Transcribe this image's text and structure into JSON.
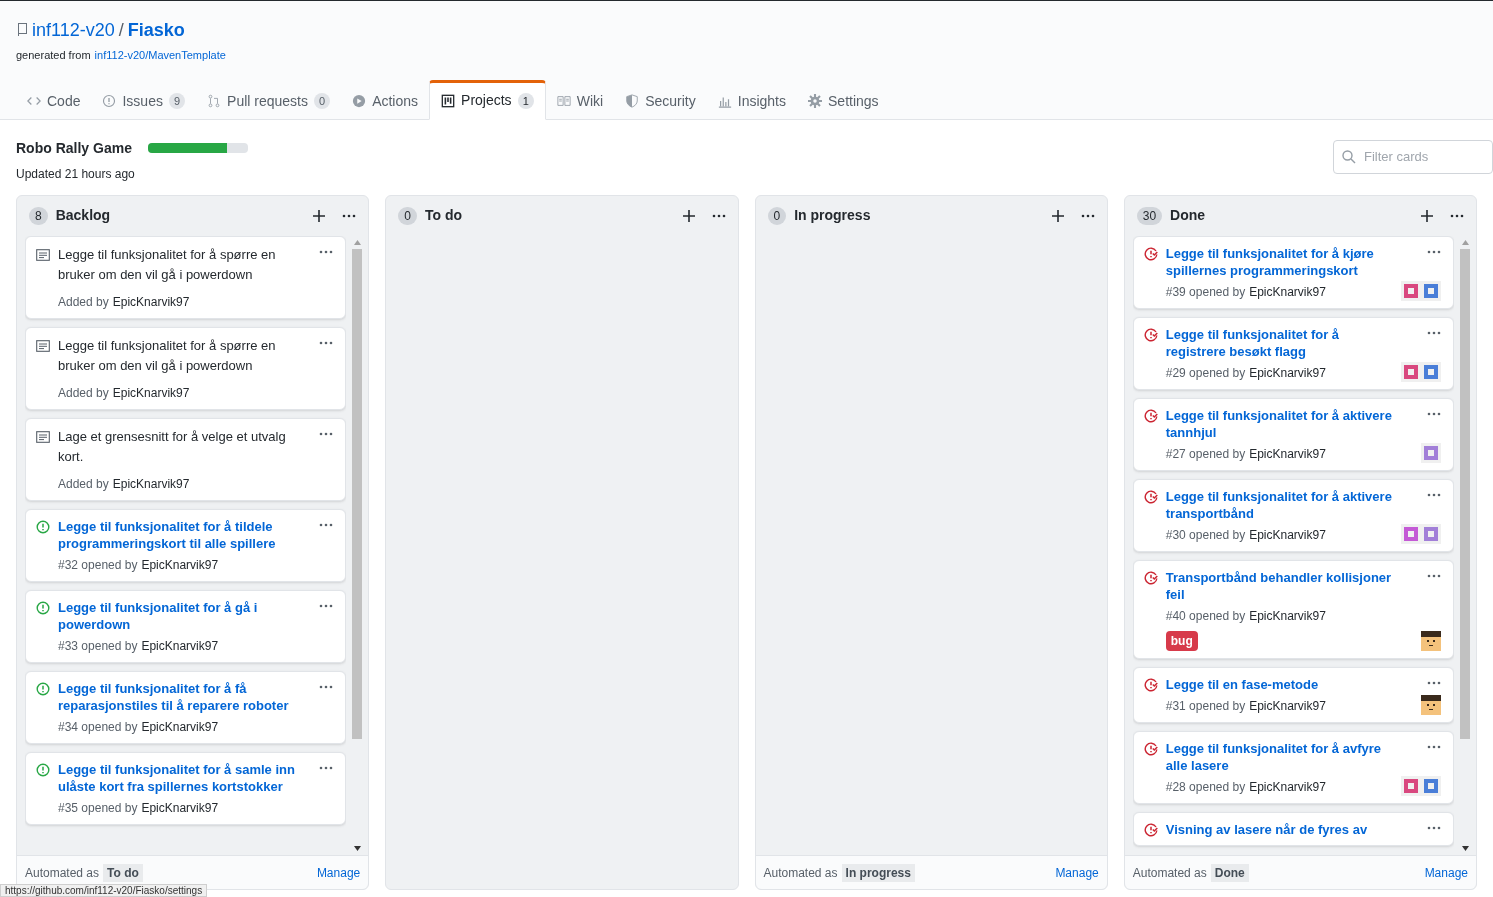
{
  "repo": {
    "owner": "inf112-v20",
    "separator": "/",
    "name": "Fiasko",
    "generated_label": "generated from",
    "template": "inf112-v20/MavenTemplate"
  },
  "tabs": [
    {
      "label": "Code",
      "selected": false
    },
    {
      "label": "Issues",
      "count": "9",
      "selected": false
    },
    {
      "label": "Pull requests",
      "count": "0",
      "selected": false
    },
    {
      "label": "Actions",
      "selected": false
    },
    {
      "label": "Projects",
      "count": "1",
      "selected": true
    },
    {
      "label": "Wiki",
      "selected": false
    },
    {
      "label": "Security",
      "selected": false
    },
    {
      "label": "Insights",
      "selected": false
    },
    {
      "label": "Settings",
      "selected": false
    }
  ],
  "project": {
    "title": "Robo Rally Game",
    "level": 0.79,
    "updated": "Updated 21 hours ago",
    "filter_placeholder": "Filter cards"
  },
  "columns": [
    {
      "count": "8",
      "name": "Backlog",
      "automated_label": "Automated as",
      "automated_value": "To do",
      "manage": "Manage",
      "cards": [
        {
          "kind": "note",
          "title": "Legge til funksjonalitet for å spørre en bruker om den vil gå i powerdown",
          "meta_label": "Added by",
          "author": "EpicKnarvik97"
        },
        {
          "kind": "note",
          "title": "Legge til funksjonalitet for å spørre en bruker om den vil gå i powerdown",
          "meta_label": "Added by",
          "author": "EpicKnarvik97"
        },
        {
          "kind": "note",
          "title": "Lage et grensesnitt for å velge et utvalg kort.",
          "meta_label": "Added by",
          "author": "EpicKnarvik97"
        },
        {
          "kind": "open_issue",
          "title": "Legge til funksjonalitet for å tildele programmeringskort til alle spillere",
          "meta_label": "#32 opened by",
          "author": "EpicKnarvik97"
        },
        {
          "kind": "open_issue",
          "title": "Legge til funksjonalitet for å gå i powerdown",
          "meta_label": "#33 opened by",
          "author": "EpicKnarvik97"
        },
        {
          "kind": "open_issue",
          "title": "Legge til funksjonalitet for å få reparasjonstiles til å reparere roboter",
          "meta_label": "#34 opened by",
          "author": "EpicKnarvik97"
        },
        {
          "kind": "open_issue",
          "title": "Legge til funksjonalitet for å samle inn ulåste kort fra spillernes kortstokker",
          "meta_label": "#35 opened by",
          "author": "EpicKnarvik97"
        }
      ]
    },
    {
      "count": "0",
      "name": "To do"
    },
    {
      "count": "0",
      "name": "In progress",
      "automated_label": "Automated as",
      "automated_value": "In progress",
      "manage": "Manage"
    },
    {
      "count": "30",
      "name": "Done",
      "automated_label": "Automated as",
      "automated_value": "Done",
      "manage": "Manage",
      "cards": [
        {
          "kind": "closed_issue",
          "title": "Legge til funksjonalitet for å kjøre spillernes programmeringskort",
          "meta_label": "#39 opened by",
          "author": "EpicKnarvik97",
          "avatars": [
            {
              "kind": "identicon",
              "color": "#d9487f"
            },
            {
              "kind": "identicon",
              "color": "#4a7ed8"
            }
          ]
        },
        {
          "kind": "closed_issue",
          "title": "Legge til funksjonalitet for å registrere besøkt flagg",
          "meta_label": "#29 opened by",
          "author": "EpicKnarvik97",
          "avatars": [
            {
              "kind": "identicon",
              "color": "#d9487f"
            },
            {
              "kind": "identicon",
              "color": "#4a7ed8"
            }
          ]
        },
        {
          "kind": "closed_issue",
          "title": "Legge til funksjonalitet for å aktivere tannhjul",
          "meta_label": "#27 opened by",
          "author": "EpicKnarvik97",
          "avatars": [
            {
              "kind": "identicon",
              "color": "#a27fd8"
            }
          ]
        },
        {
          "kind": "closed_issue",
          "title": "Legge til funksjonalitet for å aktivere transportbånd",
          "meta_label": "#30 opened by",
          "author": "EpicKnarvik97",
          "avatars": [
            {
              "kind": "identicon",
              "color": "#c45ad6"
            },
            {
              "kind": "identicon",
              "color": "#a27fd8"
            }
          ]
        },
        {
          "kind": "closed_issue",
          "title": "Transportbånd behandler kollisjoner feil",
          "meta_label": "#40 opened by",
          "author": "EpicKnarvik97",
          "label": "bug",
          "avatars": [
            {
              "kind": "person"
            }
          ]
        },
        {
          "kind": "closed_issue",
          "title": "Legge til en fase-metode",
          "meta_label": "#31 opened by",
          "author": "EpicKnarvik97",
          "avatars": [
            {
              "kind": "person"
            }
          ]
        },
        {
          "kind": "closed_issue",
          "title": "Legge til funksjonalitet for å avfyre alle lasere",
          "meta_label": "#28 opened by",
          "author": "EpicKnarvik97",
          "avatars": [
            {
              "kind": "identicon",
              "color": "#d9487f"
            },
            {
              "kind": "identicon",
              "color": "#4a7ed8"
            }
          ]
        },
        {
          "kind": "closed_issue",
          "title": "Visning av lasere når de fyres av"
        }
      ]
    }
  ],
  "status_url": "https://github.com/inf112-v20/Fiasko/settings"
}
